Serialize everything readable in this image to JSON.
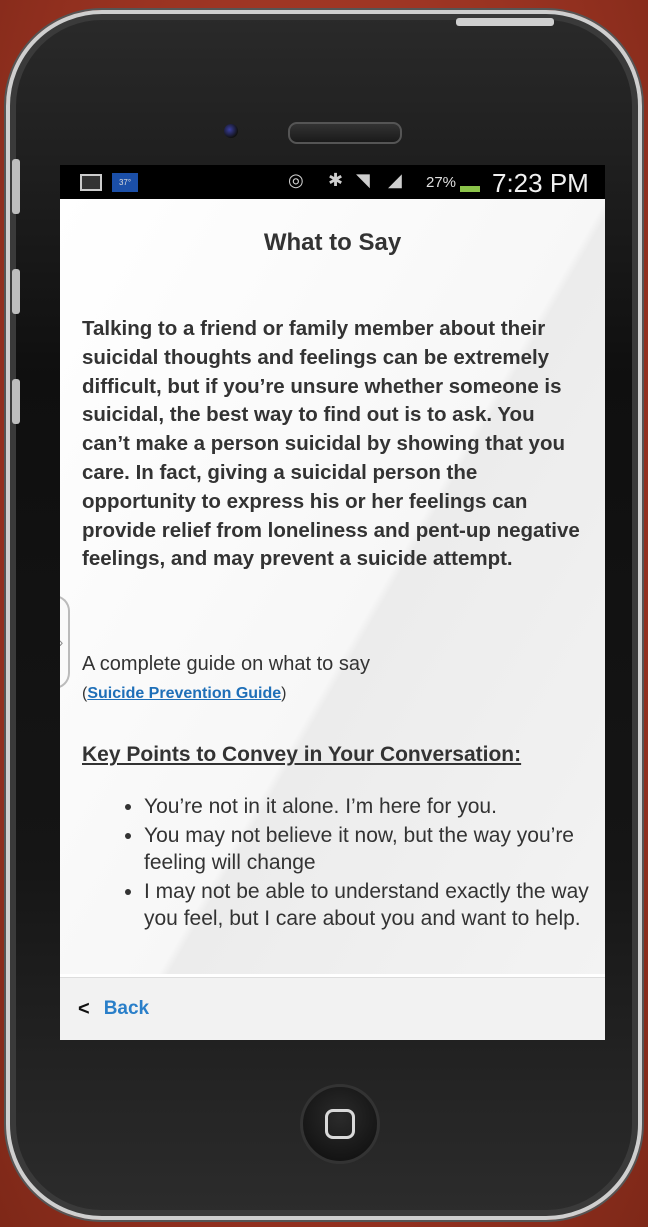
{
  "status_bar": {
    "temperature": "37°",
    "battery_percent": "27%",
    "time": "7:23 PM",
    "icons": [
      "image-icon",
      "weather-icon",
      "eye-icon",
      "bluetooth-icon",
      "wifi-icon",
      "signal-icon",
      "battery-icon"
    ]
  },
  "page": {
    "title": "What to Say",
    "intro": "Talking to a friend or family member about their suicidal thoughts and feelings can be extremely difficult, but if you’re unsure whether someone is suicidal, the best way to find out is to ask. You can’t make a person suicidal by showing that you care. In fact, giving a suicidal person the opportunity to express his or her feelings can provide relief from loneliness and pent-up negative feelings, and may prevent a suicide attempt.",
    "guide_text": "A complete guide on what to say",
    "guide_link_open": "(",
    "guide_link": "Suicide Prevention Guide",
    "guide_link_close": ")",
    "key_points_heading": "Key Points to Convey in Your Conversation:",
    "key_points": [
      "You’re not in it alone. I’m here for you.",
      "You may not believe it now, but the way you’re feeling will change",
      "I may not be able to understand exactly the way you feel, but I care about you and want to help."
    ]
  },
  "footer": {
    "back_label": "Back",
    "back_icon": "chevron-left-icon"
  },
  "colors": {
    "background": "#9a3322",
    "link": "#1e6fb8",
    "back_label": "#2a7fc9",
    "text": "#333333"
  }
}
